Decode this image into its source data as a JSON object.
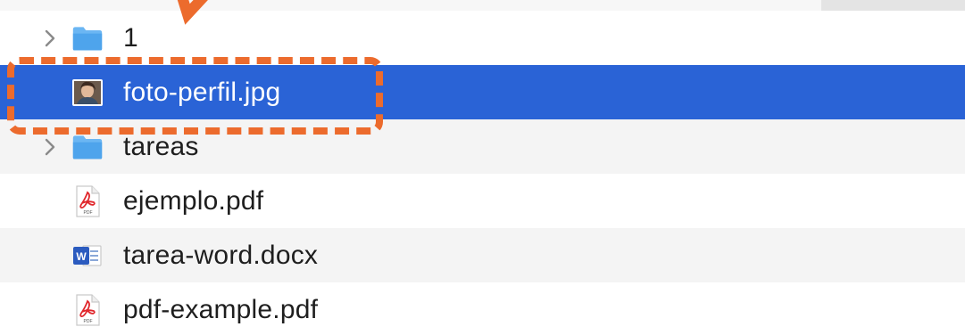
{
  "files": [
    {
      "name": "1",
      "kind": "folder",
      "expandable": true
    },
    {
      "name": "foto-perfil.jpg",
      "kind": "image",
      "expandable": false,
      "selected": true
    },
    {
      "name": "tareas",
      "kind": "folder",
      "expandable": true
    },
    {
      "name": "ejemplo.pdf",
      "kind": "pdf",
      "expandable": false
    },
    {
      "name": "tarea-word.docx",
      "kind": "word",
      "expandable": false
    },
    {
      "name": "pdf-example.pdf",
      "kind": "pdf",
      "expandable": false
    }
  ],
  "icons": {
    "folder": "folder-icon",
    "image": "image-thumbnail-icon",
    "pdf": "pdf-icon",
    "word": "word-doc-icon",
    "disclosure": "chevron-right-icon"
  },
  "colors": {
    "selection": "#2a63d6",
    "annotation": "#ec6b2d",
    "folder": "#5aaaf0"
  }
}
